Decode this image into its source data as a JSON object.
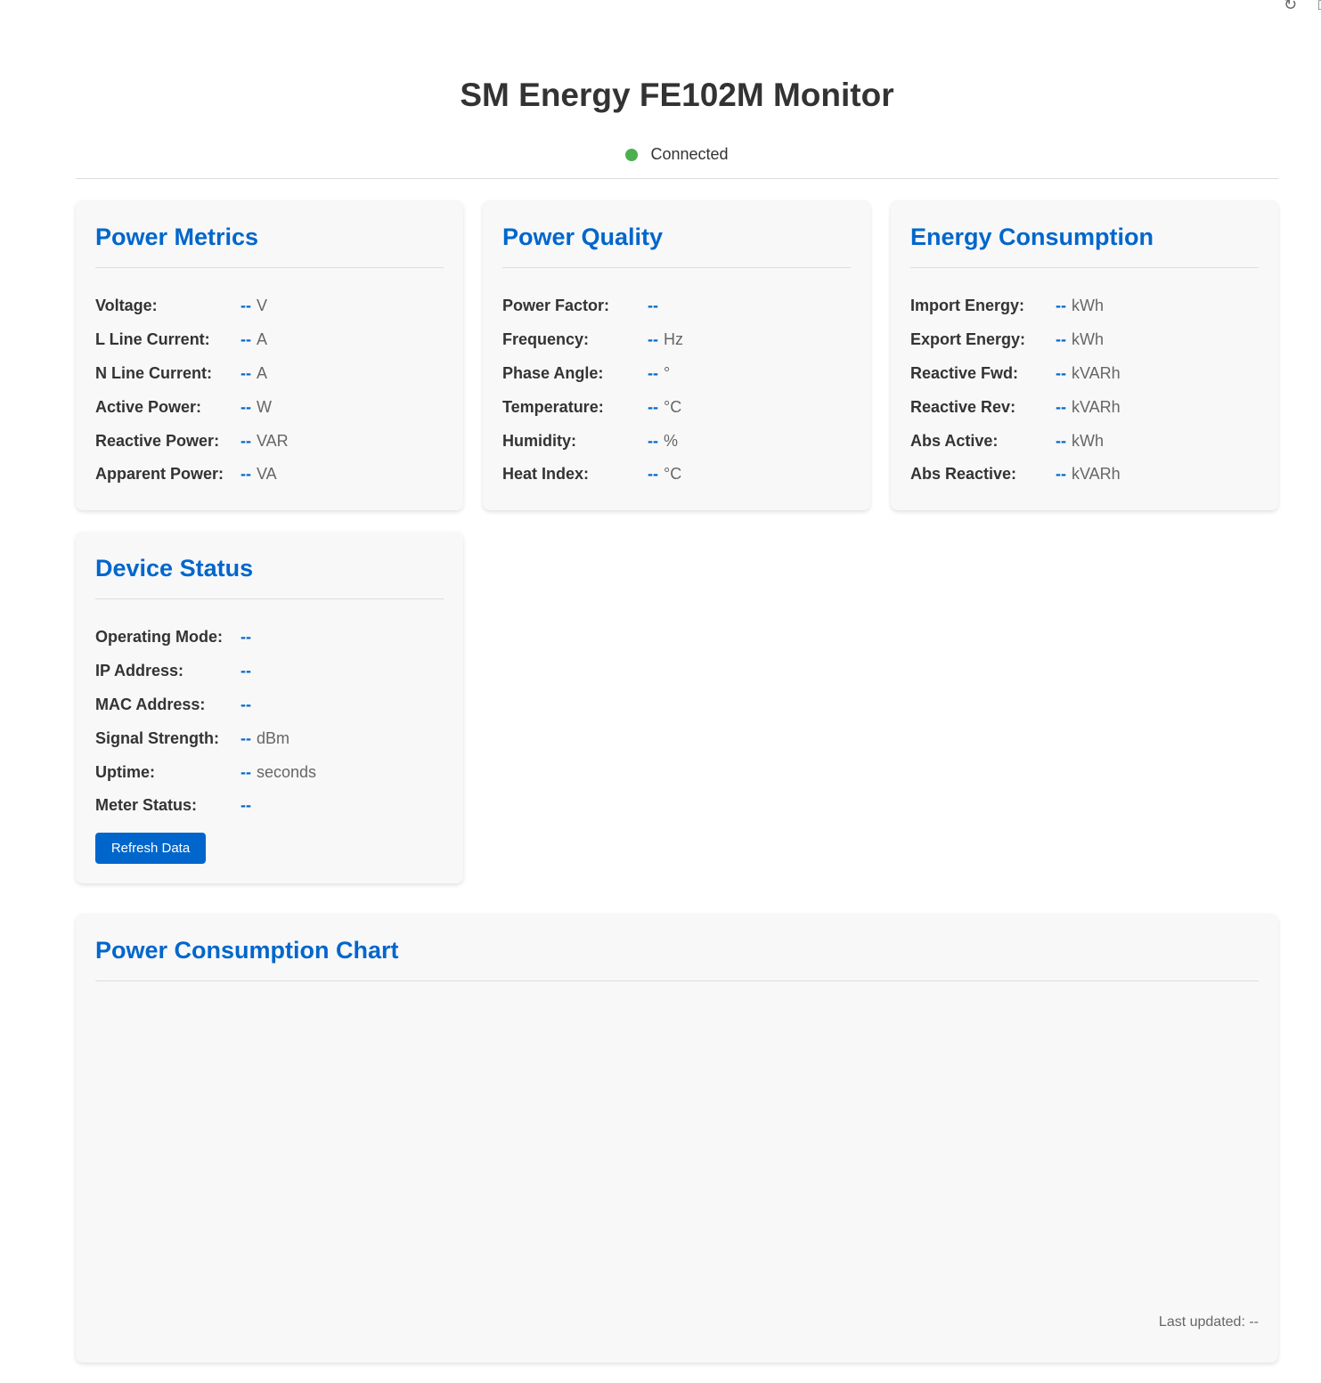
{
  "app": {
    "title": "SM Energy FE102M Monitor",
    "connection_status": "Connected",
    "status_color": "#4caf50",
    "accent_color": "#0066cc"
  },
  "power_metrics": {
    "title": "Power Metrics",
    "rows": [
      {
        "label": "Voltage:",
        "value": "--",
        "unit": "V"
      },
      {
        "label": "L Line Current:",
        "value": "--",
        "unit": "A"
      },
      {
        "label": "N Line Current:",
        "value": "--",
        "unit": "A"
      },
      {
        "label": "Active Power:",
        "value": "--",
        "unit": "W"
      },
      {
        "label": "Reactive Power:",
        "value": "--",
        "unit": "VAR"
      },
      {
        "label": "Apparent Power:",
        "value": "--",
        "unit": "VA"
      }
    ]
  },
  "power_quality": {
    "title": "Power Quality",
    "rows": [
      {
        "label": "Power Factor:",
        "value": "--",
        "unit": ""
      },
      {
        "label": "Frequency:",
        "value": "--",
        "unit": "Hz"
      },
      {
        "label": "Phase Angle:",
        "value": "--",
        "unit": "°"
      },
      {
        "label": "Temperature:",
        "value": "--",
        "unit": "°C"
      },
      {
        "label": "Humidity:",
        "value": "--",
        "unit": "%"
      },
      {
        "label": "Heat Index:",
        "value": "--",
        "unit": "°C"
      }
    ]
  },
  "energy_consumption": {
    "title": "Energy Consumption",
    "rows": [
      {
        "label": "Import Energy:",
        "value": "--",
        "unit": "kWh"
      },
      {
        "label": "Export Energy:",
        "value": "--",
        "unit": "kWh"
      },
      {
        "label": "Reactive Fwd:",
        "value": "--",
        "unit": "kVARh"
      },
      {
        "label": "Reactive Rev:",
        "value": "--",
        "unit": "kVARh"
      },
      {
        "label": "Abs Active:",
        "value": "--",
        "unit": "kWh"
      },
      {
        "label": "Abs Reactive:",
        "value": "--",
        "unit": "kVARh"
      }
    ]
  },
  "device_status": {
    "title": "Device Status",
    "rows": [
      {
        "label": "Operating Mode:",
        "value": "--",
        "unit": ""
      },
      {
        "label": "IP Address:",
        "value": "--",
        "unit": ""
      },
      {
        "label": "MAC Address:",
        "value": "--",
        "unit": ""
      },
      {
        "label": "Signal Strength:",
        "value": "--",
        "unit": "dBm"
      },
      {
        "label": "Uptime:",
        "value": "--",
        "unit": "seconds"
      },
      {
        "label": "Meter Status:",
        "value": "--",
        "unit": ""
      }
    ],
    "refresh_label": "Refresh Data"
  },
  "chart": {
    "title": "Power Consumption Chart",
    "last_updated": "Last updated: --"
  },
  "icons": {
    "corner_1": "refresh-icon",
    "corner_2": "expand-icon"
  }
}
